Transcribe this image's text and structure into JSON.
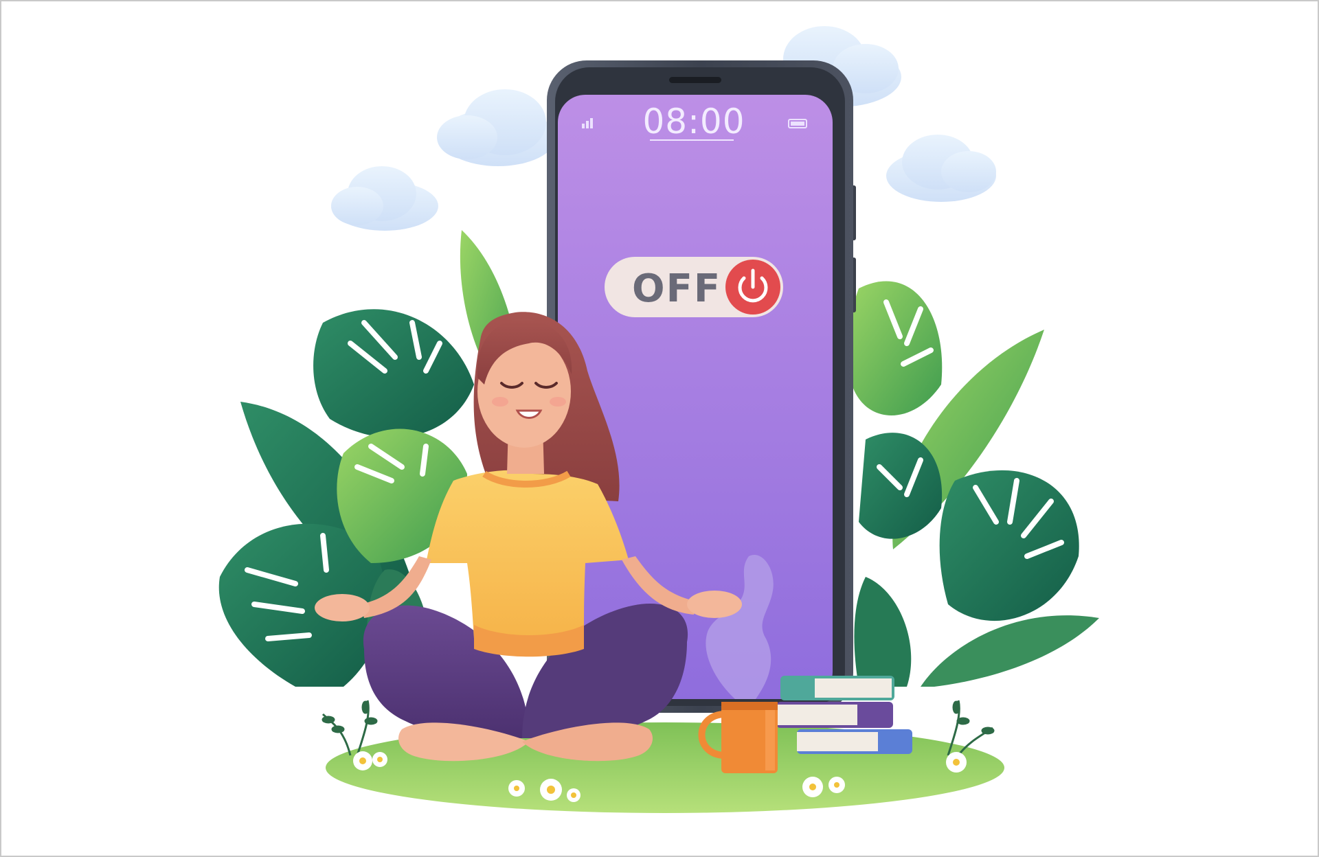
{
  "phone": {
    "time": "08:00",
    "toggle_label": "OFF"
  },
  "colors": {
    "screen_top": "#bd8fe6",
    "screen_bottom": "#8f6ddd",
    "toggle_button": "#e24b4e",
    "shirt": "#f9c25a",
    "pants": "#5d3f82",
    "hair": "#9c4d4a",
    "grass": "#93cf63",
    "leaf_dark": "#1f7a5c",
    "leaf_light": "#7fc65a",
    "mug": "#f08a36"
  },
  "icons": [
    "signal-icon",
    "battery-icon",
    "power-icon",
    "cloud-icon",
    "monstera-leaf-icon",
    "daisy-icon",
    "book-icon",
    "mug-icon",
    "steam-icon"
  ]
}
